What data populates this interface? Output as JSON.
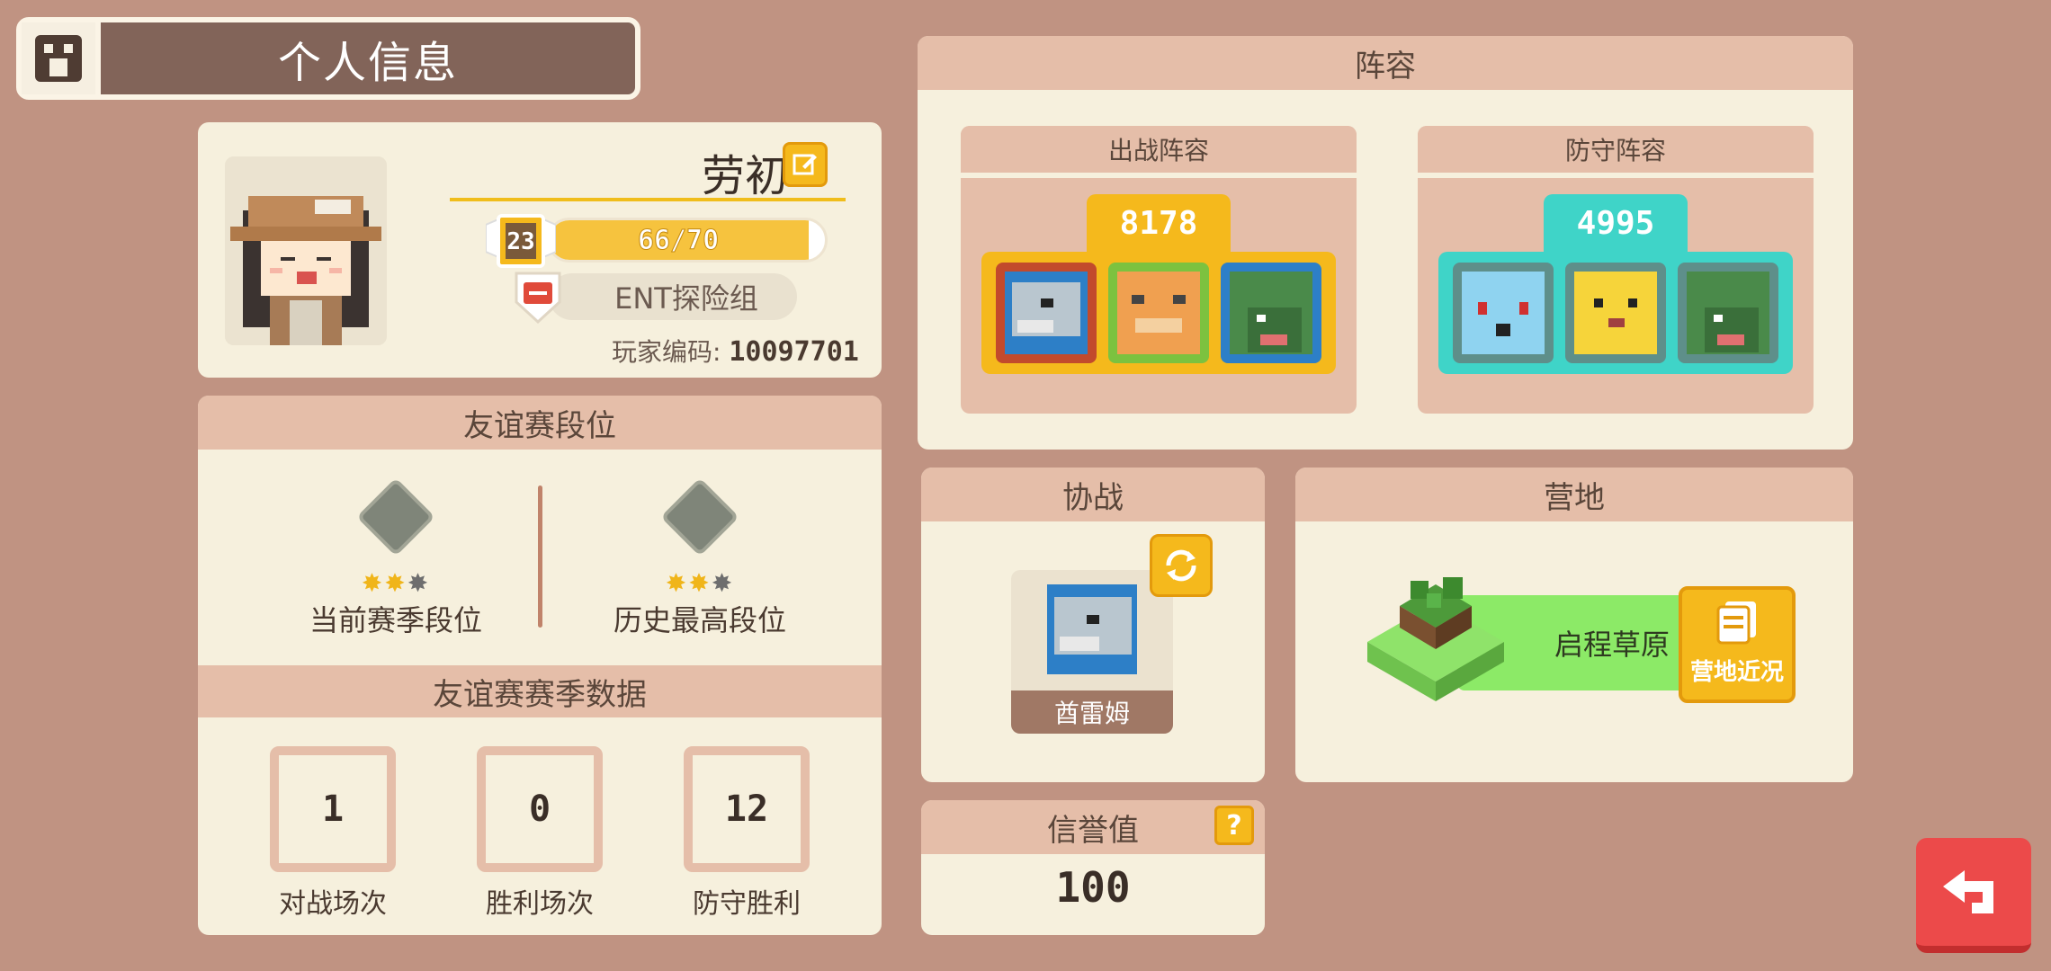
{
  "header": {
    "title": "个人信息",
    "icon": "profile-card-icon"
  },
  "profile": {
    "name": "劳初",
    "level": "23",
    "exp_text": "66/70",
    "exp_fraction": 0.94,
    "team": "ENT探险组",
    "player_id_label": "玩家编码:",
    "player_id_value": "10097701"
  },
  "rank": {
    "title": "友谊赛段位",
    "current_label": "当前赛季段位",
    "best_label": "历史最高段位",
    "current_stars": 2,
    "best_stars": 2,
    "max_stars": 3
  },
  "season": {
    "title": "友谊赛赛季数据",
    "stats": [
      {
        "value": "1",
        "label": "对战场次"
      },
      {
        "value": "0",
        "label": "胜利场次"
      },
      {
        "value": "12",
        "label": "防守胜利"
      }
    ]
  },
  "lineup": {
    "title": "阵容",
    "attack": {
      "title": "出战阵容",
      "power": "8178",
      "color": "#f5b91c"
    },
    "defense": {
      "title": "防守阵容",
      "power": "4995",
      "color": "#3fd4c8"
    }
  },
  "coop": {
    "title": "协战",
    "pokemon_name": "酋雷姆"
  },
  "reputation": {
    "title": "信誉值",
    "value": "100"
  },
  "camp": {
    "title": "营地",
    "name": "启程草原",
    "status_button": "营地近况"
  },
  "colors": {
    "background": "#c09382",
    "panel": "#f6f0dd",
    "panel_header": "#e5bea9",
    "accent_yellow": "#f5b91c",
    "back_red": "#ec4a4a"
  }
}
